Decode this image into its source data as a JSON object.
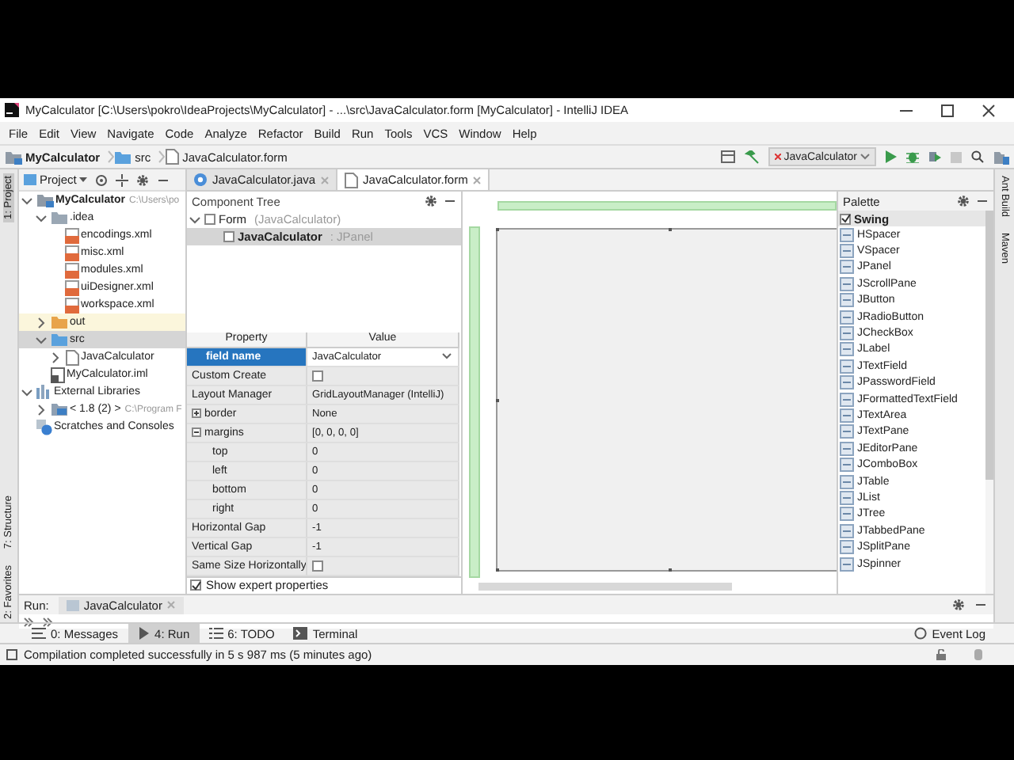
{
  "window": {
    "title": "MyCalculator [C:\\Users\\pokro\\IdeaProjects\\MyCalculator] - ...\\src\\JavaCalculator.form [MyCalculator] - IntelliJ IDEA"
  },
  "menu": [
    "File",
    "Edit",
    "View",
    "Navigate",
    "Code",
    "Analyze",
    "Refactor",
    "Build",
    "Run",
    "Tools",
    "VCS",
    "Window",
    "Help"
  ],
  "breadcrumbs": [
    {
      "label": "MyCalculator",
      "kind": "project"
    },
    {
      "label": "src",
      "kind": "folder"
    },
    {
      "label": "JavaCalculator.form",
      "kind": "form"
    }
  ],
  "run_config": "JavaCalculator",
  "left_stripe": [
    {
      "label": "1: Project",
      "selected": true
    },
    {
      "label": "7: Structure",
      "selected": false
    },
    {
      "label": "2: Favorites",
      "selected": false
    }
  ],
  "right_stripe": [
    {
      "label": "Ant Build"
    },
    {
      "label": "Maven"
    }
  ],
  "project_panel": {
    "title": "Project",
    "tree": [
      {
        "label": "MyCalculator",
        "detail": "C:\\Users\\po",
        "kind": "project",
        "expanded": true,
        "selected": false,
        "children": [
          {
            "label": ".idea",
            "kind": "folder",
            "expanded": true,
            "selected": false,
            "children": [
              {
                "label": "encodings.xml",
                "kind": "xml",
                "selected": false
              },
              {
                "label": "misc.xml",
                "kind": "xml",
                "selected": false
              },
              {
                "label": "modules.xml",
                "kind": "xml",
                "selected": false
              },
              {
                "label": "uiDesigner.xml",
                "kind": "xml",
                "selected": false
              },
              {
                "label": "workspace.xml",
                "kind": "xml",
                "selected": false
              }
            ]
          },
          {
            "label": "out",
            "kind": "excluded-folder",
            "expanded": false,
            "selected": false
          },
          {
            "label": "src",
            "kind": "source-folder",
            "expanded": true,
            "selected": true,
            "children": [
              {
                "label": "JavaCalculator",
                "kind": "form",
                "expanded": false,
                "selected": false
              }
            ]
          },
          {
            "label": "MyCalculator.iml",
            "kind": "iml",
            "selected": false
          }
        ]
      },
      {
        "label": "External Libraries",
        "kind": "library",
        "expanded": true,
        "selected": false,
        "children": [
          {
            "label": "< 1.8 (2) >",
            "detail": "C:\\Program F",
            "kind": "sdk",
            "expanded": false,
            "selected": false
          }
        ]
      },
      {
        "label": "Scratches and Consoles",
        "kind": "scratches",
        "selected": false
      }
    ]
  },
  "editor_tabs": [
    {
      "label": "JavaCalculator.java",
      "kind": "class",
      "selected": false
    },
    {
      "label": "JavaCalculator.form",
      "kind": "form",
      "selected": true
    }
  ],
  "component_tree": {
    "title": "Component Tree",
    "items": [
      {
        "label": "Form",
        "detail": "(JavaCalculator)",
        "expanded": true,
        "selected": false,
        "children": [
          {
            "label": "JavaCalculator",
            "detail": ": JPanel",
            "selected": true
          }
        ]
      }
    ]
  },
  "properties": {
    "columns": [
      "Property",
      "Value"
    ],
    "rows": [
      {
        "name": "field name",
        "value": "JavaCalculator",
        "kind": "combo",
        "selected": true
      },
      {
        "name": "Custom Create",
        "kind": "checkbox",
        "checked": false,
        "selected": false
      },
      {
        "name": "Layout Manager",
        "value": "GridLayoutManager (IntelliJ)",
        "kind": "text",
        "selected": false
      },
      {
        "name": "border",
        "value": "None",
        "kind": "group",
        "expanded": false,
        "selected": false
      },
      {
        "name": "margins",
        "value": "[0, 0, 0, 0]",
        "kind": "group",
        "expanded": true,
        "selected": false,
        "children": [
          {
            "name": "top",
            "value": "0",
            "kind": "text",
            "selected": false
          },
          {
            "name": "left",
            "value": "0",
            "kind": "text",
            "selected": false
          },
          {
            "name": "bottom",
            "value": "0",
            "kind": "text",
            "selected": false
          },
          {
            "name": "right",
            "value": "0",
            "kind": "text",
            "selected": false
          }
        ]
      },
      {
        "name": "Horizontal Gap",
        "value": "-1",
        "kind": "text",
        "selected": false
      },
      {
        "name": "Vertical Gap",
        "value": "-1",
        "kind": "text",
        "selected": false
      },
      {
        "name": "Same Size Horizontally",
        "kind": "checkbox",
        "checked": false,
        "selected": false
      }
    ],
    "show_expert": {
      "label": "Show expert properties",
      "checked": true
    }
  },
  "palette": {
    "title": "Palette",
    "group": {
      "label": "Swing",
      "expanded": true,
      "items": [
        "HSpacer",
        "VSpacer",
        "JPanel",
        "JScrollPane",
        "JButton",
        "JRadioButton",
        "JCheckBox",
        "JLabel",
        "JTextField",
        "JPasswordField",
        "JFormattedTextField",
        "JTextArea",
        "JTextPane",
        "JEditorPane",
        "JComboBox",
        "JTable",
        "JList",
        "JTree",
        "JTabbedPane",
        "JSplitPane",
        "JSpinner"
      ]
    }
  },
  "run_panel": {
    "label": "Run:",
    "tab": "JavaCalculator"
  },
  "tool_tabs": [
    {
      "label": "0: Messages",
      "kind": "messages",
      "selected": false
    },
    {
      "label": "4: Run",
      "kind": "run",
      "selected": true
    },
    {
      "label": "6: TODO",
      "kind": "todo",
      "selected": false
    },
    {
      "label": "Terminal",
      "kind": "terminal",
      "selected": false
    }
  ],
  "event_log": "Event Log",
  "status": "Compilation completed successfully in 5 s 987 ms (5 minutes ago)"
}
